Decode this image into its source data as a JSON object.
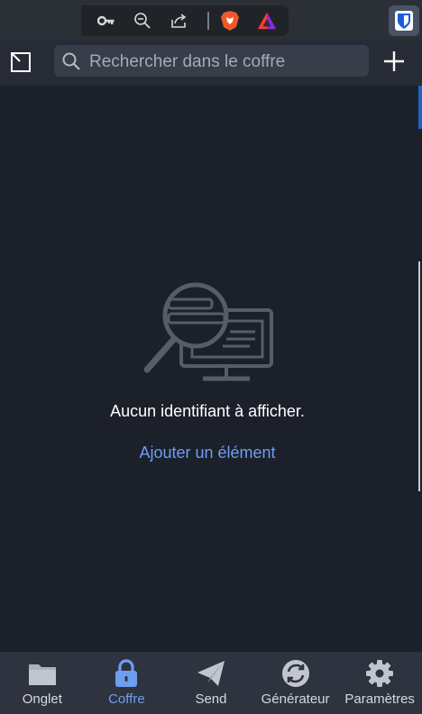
{
  "browser": {
    "icons": [
      "key-icon",
      "zoom-out-icon",
      "share-icon",
      "brave-shield-icon",
      "brave-rewards-icon",
      "bitwarden-extension-icon"
    ]
  },
  "header": {
    "search_placeholder": "Rechercher dans le coffre",
    "icons": [
      "popout-icon",
      "search-icon",
      "plus-icon"
    ]
  },
  "empty_state": {
    "message": "Aucun identifiant à afficher.",
    "add_link": "Ajouter un élément"
  },
  "nav": {
    "items": [
      {
        "label": "Onglet",
        "icon": "folder-icon",
        "active": false
      },
      {
        "label": "Coffre",
        "icon": "lock-icon",
        "active": true
      },
      {
        "label": "Send",
        "icon": "paper-plane-icon",
        "active": false
      },
      {
        "label": "Générateur",
        "icon": "refresh-icon",
        "active": false
      },
      {
        "label": "Paramètres",
        "icon": "gear-icon",
        "active": false
      }
    ]
  },
  "colors": {
    "background": "#1b202a",
    "header": "#262b35",
    "search_bg": "#373d49",
    "accent": "#6e9ef0",
    "nav_bg": "#2e333f"
  }
}
